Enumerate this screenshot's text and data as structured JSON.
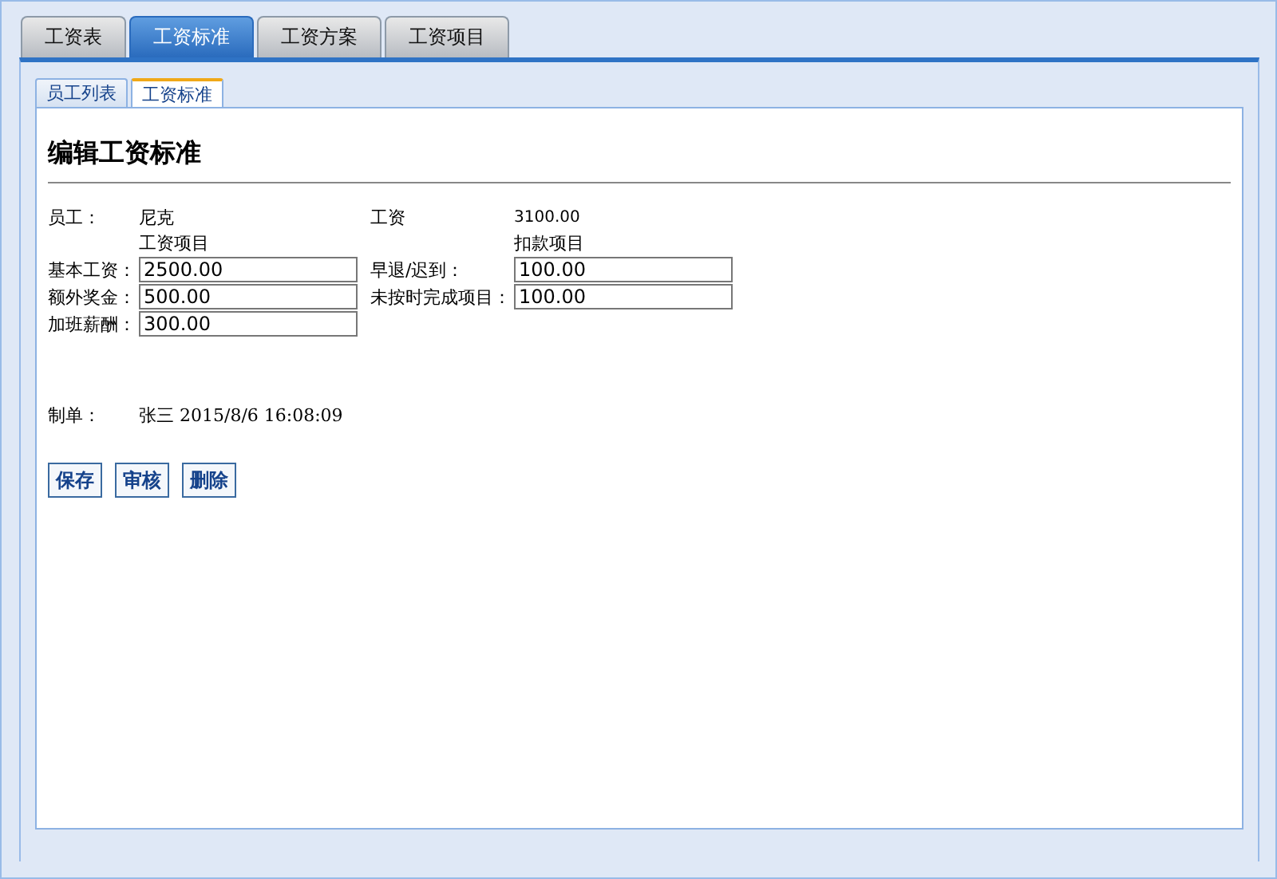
{
  "main_tabs": [
    {
      "label": "工资表",
      "selected": false
    },
    {
      "label": "工资标准",
      "selected": true
    },
    {
      "label": "工资方案",
      "selected": false
    },
    {
      "label": "工资项目",
      "selected": false
    }
  ],
  "sub_tabs": [
    {
      "label": "员工列表",
      "selected": false
    },
    {
      "label": "工资标准",
      "selected": true
    }
  ],
  "title": "编辑工资标准",
  "employee": {
    "label": "员工：",
    "value": "尼克"
  },
  "salary": {
    "label": "工资",
    "value": "3100.00"
  },
  "income": {
    "heading": "工资项目",
    "fields": [
      {
        "label": "基本工资：",
        "value": "2500.00"
      },
      {
        "label": "额外奖金：",
        "value": "500.00"
      },
      {
        "label": "加班薪酬：",
        "value": "300.00"
      }
    ]
  },
  "deductions": {
    "heading": "扣款项目",
    "fields": [
      {
        "label": "早退/迟到：",
        "value": "100.00"
      },
      {
        "label": "未按时完成项目：",
        "value": "100.00"
      }
    ]
  },
  "prepared_by": {
    "label": "制单：",
    "value": "张三 2015/8/6 16:08:09"
  },
  "buttons": [
    "保存",
    "审核",
    "删除"
  ]
}
